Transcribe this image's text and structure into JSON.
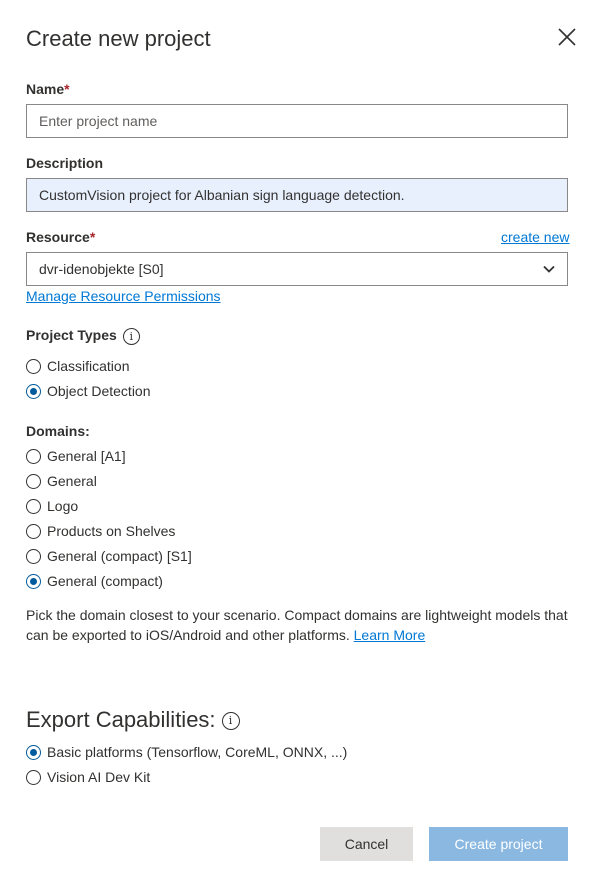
{
  "dialog": {
    "title": "Create new project"
  },
  "name_field": {
    "label": "Name",
    "required_mark": "*",
    "placeholder": "Enter project name",
    "value": ""
  },
  "description_field": {
    "label": "Description",
    "value": "CustomVision project for Albanian sign language detection."
  },
  "resource_field": {
    "label": "Resource",
    "required_mark": "*",
    "create_new_link": "create new",
    "selected": "dvr-idenobjekte [S0]",
    "manage_link": "Manage Resource Permissions"
  },
  "project_types": {
    "label": "Project Types",
    "info_glyph": "i",
    "options": [
      {
        "label": "Classification",
        "selected": false
      },
      {
        "label": "Object Detection",
        "selected": true
      }
    ]
  },
  "domains": {
    "label": "Domains:",
    "options": [
      {
        "label": "General [A1]",
        "selected": false
      },
      {
        "label": "General",
        "selected": false
      },
      {
        "label": "Logo",
        "selected": false
      },
      {
        "label": "Products on Shelves",
        "selected": false
      },
      {
        "label": "General (compact) [S1]",
        "selected": false
      },
      {
        "label": "General (compact)",
        "selected": true
      }
    ],
    "help_text": "Pick the domain closest to your scenario. Compact domains are lightweight models that can be exported to iOS/Android and other platforms.",
    "learn_more": "Learn More"
  },
  "export": {
    "title": "Export Capabilities:",
    "info_glyph": "i",
    "options": [
      {
        "label": "Basic platforms (Tensorflow, CoreML, ONNX, ...)",
        "selected": true
      },
      {
        "label": "Vision AI Dev Kit",
        "selected": false
      }
    ]
  },
  "footer": {
    "cancel_label": "Cancel",
    "create_label": "Create project"
  },
  "colors": {
    "accent": "#0078d4",
    "radio_selected": "#005a9e",
    "create_button_disabled": "#8ab8e0",
    "cancel_button": "#e1dfdd",
    "required": "#a4262c"
  }
}
